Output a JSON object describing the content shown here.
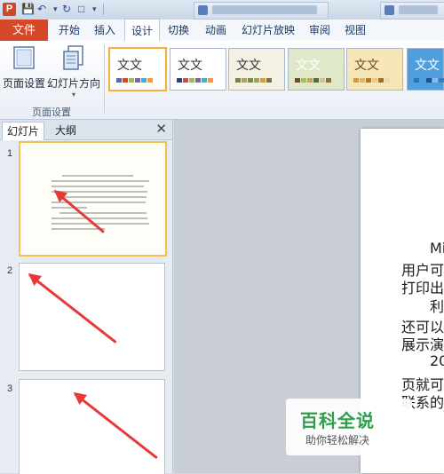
{
  "tabs": {
    "file": "文件",
    "home": "开始",
    "insert": "插入",
    "design": "设计",
    "transitions": "切换",
    "animations": "动画",
    "slideshow": "幻灯片放映",
    "review": "审阅",
    "view": "视图"
  },
  "ribbon": {
    "page_setup": "页面设置",
    "orientation": "幻灯片方向",
    "group_label": "页面设置",
    "theme_text": "文文",
    "themes": [
      {
        "colors": [
          "#4a6fb5",
          "#d24726",
          "#9bbb59",
          "#8064a2",
          "#4bacc6",
          "#f79646"
        ]
      },
      {
        "colors": [
          "#1f497d",
          "#c0504d",
          "#9bbb59",
          "#8064a2",
          "#4bacc6",
          "#f79646"
        ]
      },
      {
        "colors": [
          "#7f7f3f",
          "#a5a56a",
          "#6f8f3f",
          "#9f9f5f",
          "#cfa03f",
          "#7f6f3f"
        ]
      },
      {
        "colors": [
          "#6e4b2a",
          "#9fbf6a",
          "#c7a16b",
          "#4f6f3a",
          "#d4c08b",
          "#8c6b3f"
        ]
      },
      {
        "colors": [
          "#c99e3a",
          "#d9b86a",
          "#b07a2a",
          "#e3c98f",
          "#9f6f2f",
          "#f2d99f"
        ]
      },
      {
        "colors": [
          "#2f6fbf",
          "#4f9fdf",
          "#1f4f8f",
          "#7fbfef",
          "#3f7faf",
          "#afdfff"
        ]
      }
    ]
  },
  "pane": {
    "tab_slides": "幻灯片",
    "tab_outline": "大纲",
    "close": "✕",
    "slides": [
      "1",
      "2",
      "3"
    ]
  },
  "slide": {
    "lines": [
      "Mi",
      "用户可",
      "打印出",
      "利",
      "还可以",
      "展示演",
      "20",
      "页就可",
      "联系的"
    ]
  },
  "watermark": {
    "title": "百科全说",
    "subtitle": "助你轻松解决"
  }
}
